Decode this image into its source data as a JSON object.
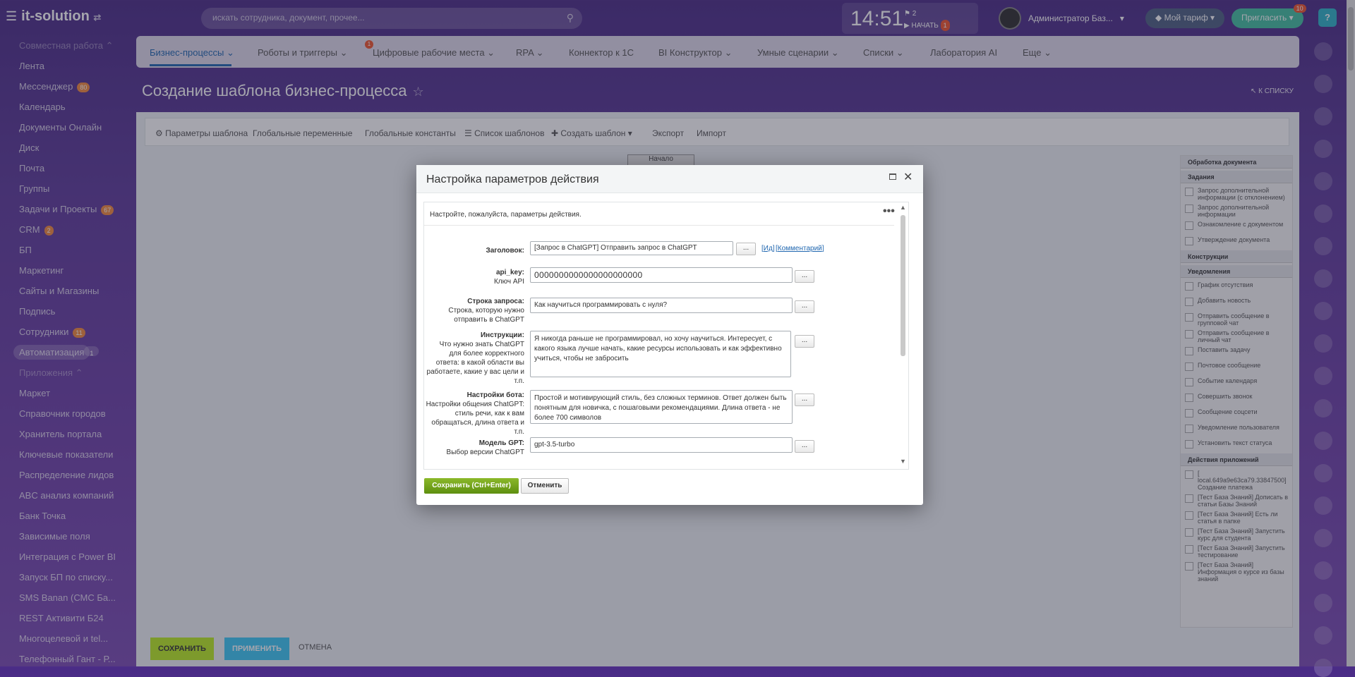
{
  "header": {
    "logo": "it-solution",
    "search_placeholder": "искать сотрудника, документ, прочее...",
    "time": "14:51",
    "flag_count": "2",
    "start_label": "НАЧАТЬ",
    "start_badge": "1",
    "user_name": "Администратор Баз...",
    "tariff": "Мой тариф",
    "invite": "Пригласить",
    "invite_badge": "10",
    "help": "?"
  },
  "sidebar": {
    "group1": "Совместная работа",
    "items1": [
      {
        "label": "Лента"
      },
      {
        "label": "Мессенджер",
        "badge": "80"
      },
      {
        "label": "Календарь"
      },
      {
        "label": "Документы Онлайн"
      },
      {
        "label": "Диск"
      },
      {
        "label": "Почта"
      },
      {
        "label": "Группы"
      },
      {
        "label": "Задачи и Проекты",
        "badge": "67"
      },
      {
        "label": "CRM",
        "badge": "2"
      },
      {
        "label": "БП"
      },
      {
        "label": "Маркетинг"
      },
      {
        "label": "Сайты и Магазины"
      },
      {
        "label": "Подпись"
      },
      {
        "label": "Сотрудники",
        "badge": "11"
      },
      {
        "label": "Автоматизация",
        "badge": "1"
      }
    ],
    "group2": "Приложения",
    "items2": [
      "Маркет",
      "Справочник городов",
      "Хранитель портала",
      "Ключевые показатели",
      "Распределение лидов",
      "ABC анализ компаний",
      "Банк Точка",
      "Зависимые поля",
      "Интеграция с Power BI",
      "Запуск БП по списку...",
      "SMS Banan (СМС Ба...",
      "REST Активити Б24",
      "Многоцелевой и tel...",
      "Телефонный Гант - Р..."
    ]
  },
  "menu": {
    "items": [
      "Бизнес-процессы",
      "Роботы и триггеры",
      "Цифровые рабочие места",
      "RPA",
      "Коннектор к 1С",
      "BI Конструктор",
      "Умные сценарии",
      "Списки",
      "Лаборатория AI",
      "Еще"
    ],
    "badge": "1"
  },
  "page": {
    "title": "Создание шаблона бизнес-процесса",
    "to_list": "К СПИСКУ"
  },
  "toolbar": {
    "items": [
      "Параметры шаблона",
      "Глобальные переменные",
      "Глобальные константы",
      "Список шаблонов",
      "Создать шаблон",
      "Экспорт",
      "Импорт"
    ]
  },
  "canvas": {
    "start_node": "Начало"
  },
  "action_panel": {
    "sections": [
      {
        "title": "Обработка документа",
        "items": []
      },
      {
        "title": "Задания",
        "items": [
          "Запрос дополнительной информации (с отклонением)",
          "Запрос дополнительной информации",
          "Ознакомление с документом",
          "Утверждение документа"
        ]
      },
      {
        "title": "Конструкции",
        "items": []
      },
      {
        "title": "Уведомления",
        "items": [
          "График отсутствия",
          "Добавить новость",
          "Отправить сообщение в групповой чат",
          "Отправить сообщение в личный чат",
          "Поставить задачу",
          "Почтовое сообщение",
          "Событие календаря",
          "Совершить звонок",
          "Сообщение соцсети",
          "Уведомление пользователя",
          "Установить текст статуса"
        ]
      },
      {
        "title": "Действия приложений",
        "items": [
          "[ local.649a9e63ca79.33847500] Создание платежа",
          "[Тест База Знаний] Дописать в статьи Базы Знаний",
          "[Тест База Знаний] Есть ли статья в папке",
          "[Тест База Знаний] Запустить курс для студента",
          "[Тест База Знаний] Запустить тестирование",
          "[Тест База Знаний] Информация о курсе из базы знаний"
        ]
      }
    ]
  },
  "bottom_bar": {
    "save": "СОХРАНИТЬ",
    "apply": "ПРИМЕНИТЬ",
    "cancel": "ОТМЕНА"
  },
  "modal": {
    "title": "Настройка параметров действия",
    "hint": "Настройте, пожалуйста, параметры действия.",
    "fields": {
      "title": {
        "label": "Заголовок:",
        "value": "[Запрос в ChatGPT] Отправить запрос в ChatGPT",
        "link_id": "Ид",
        "link_comment": "Комментарий"
      },
      "api_key": {
        "label": "api_key:",
        "sublabel": "Ключ API",
        "value": "0000000000000000000000"
      },
      "query": {
        "label": "Строка запроса:",
        "sublabel": "Строка, которую нужно отправить в ChatGPT",
        "value": "Как научиться программировать с нуля?"
      },
      "instructions": {
        "label": "Инструкции:",
        "sublabel": "Что нужно знать ChatGPT для более корректного ответа: в какой области вы работаете, какие у вас цели и т.п.",
        "value": "Я никогда раньше не программировал, но хочу научиться. Интересует, с какого языка лучше начать, какие ресурсы использовать и как эффективно учиться, чтобы не забросить"
      },
      "bot": {
        "label": "Настройки бота:",
        "sublabel": "Настройки общения ChatGPT: стиль речи, как к вам обращаться, длина ответа и т.п.",
        "value": "Простой и мотивирующий стиль, без сложных терминов. Ответ должен быть понятным для новичка, с пошаговыми рекомендациями. Длина ответа - не более 700 символов"
      },
      "model": {
        "label": "Модель GPT:",
        "sublabel": "Выбор версии ChatGPT",
        "value": "gpt-3.5-turbo"
      }
    },
    "dots": "...",
    "save": "Сохранить (Ctrl+Enter)",
    "cancel": "Отменить"
  }
}
